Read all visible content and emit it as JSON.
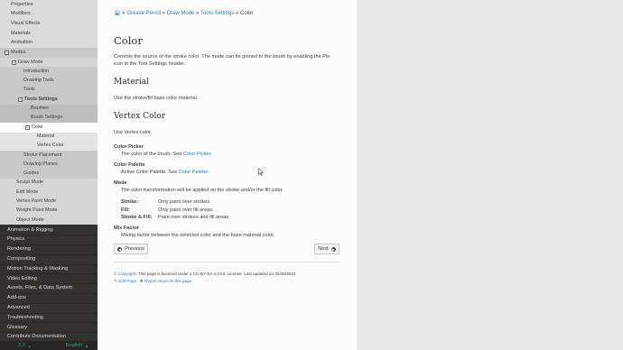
{
  "sidebar": {
    "top_items": [
      "Properties",
      "Modifiers",
      "Visual Effects",
      "Materials",
      "Animation"
    ],
    "modes": {
      "label": "Modes",
      "draw_mode": {
        "label": "Draw Mode",
        "children_before": [
          "Introduction",
          "Drawing Tools",
          "Tools"
        ],
        "tools_settings": {
          "label": "Tools Settings",
          "children_before": [
            "Brushes",
            "Brush Settings"
          ],
          "color": {
            "label": "Color",
            "children": [
              "Material",
              "Vertex Color"
            ]
          },
          "children_after": [
            "Stroke Placement",
            "Drawing Planes",
            "Guides"
          ]
        }
      },
      "other_modes": [
        "Sculpt Mode",
        "Edit Mode",
        "Vertex Paint Mode",
        "Weight Paint Mode",
        "Object Mode"
      ]
    },
    "bottom_items": [
      "Animation & Rigging",
      "Physics",
      "Rendering",
      "Compositing",
      "Motion Tracking & Masking",
      "Video Editing",
      "Assets, Files, & Data System",
      "Add-ons",
      "Advanced",
      "Troubleshooting",
      "Glossary",
      "Contribute Documentation"
    ],
    "version": "3.2",
    "language": "English"
  },
  "breadcrumb": {
    "items": [
      "Grease Pencil",
      "Draw Mode",
      "Tools Settings"
    ],
    "current": "Color",
    "separator": "»"
  },
  "page": {
    "title": "Color",
    "intro": "Controls the source of the stroke color. The mode can be pinned to the brush by enabling the Pin icon in the Tool Settings header.",
    "material": {
      "heading": "Material",
      "text": "Use the stroke/fill base color material."
    },
    "vertex_color": {
      "heading": "Vertex Color",
      "text": "Use Vertex color.",
      "color_picker": {
        "term": "Color Picker",
        "desc": "The color of the brush. See ",
        "link": "Color Picker",
        "after": "."
      },
      "color_palette": {
        "term": "Color Palette",
        "desc": "Active Color Palette. See ",
        "link": "Color Palette",
        "after": "."
      },
      "mode": {
        "term": "Mode",
        "desc": "The color transformation will be applied on the stroke and/or the fill color.",
        "options": [
          {
            "key": "Stroke:",
            "value": "Only paint over strokes."
          },
          {
            "key": "Fill:",
            "value": "Only paint over fill areas."
          },
          {
            "key": "Stroke & Fill:",
            "value": "Paint over strokes and fill areas."
          }
        ]
      },
      "mix_factor": {
        "term": "Mix Factor",
        "desc": "Mixing factor between the selected color and the base material color."
      }
    },
    "prev_label": "Previous",
    "next_label": "Next"
  },
  "footer": {
    "copyright_link": "© Copyright",
    "license_text": ": This page is licensed under a CC-BY-SA 4.0 Int. License. Last updated on 02/26/2022.",
    "edit_page": "Edit Page",
    "report_issue": "Report issue on this page"
  },
  "colors": {
    "link": "#2980b9",
    "sidebar_dark": "#343131",
    "version_green": "#27ae60"
  }
}
